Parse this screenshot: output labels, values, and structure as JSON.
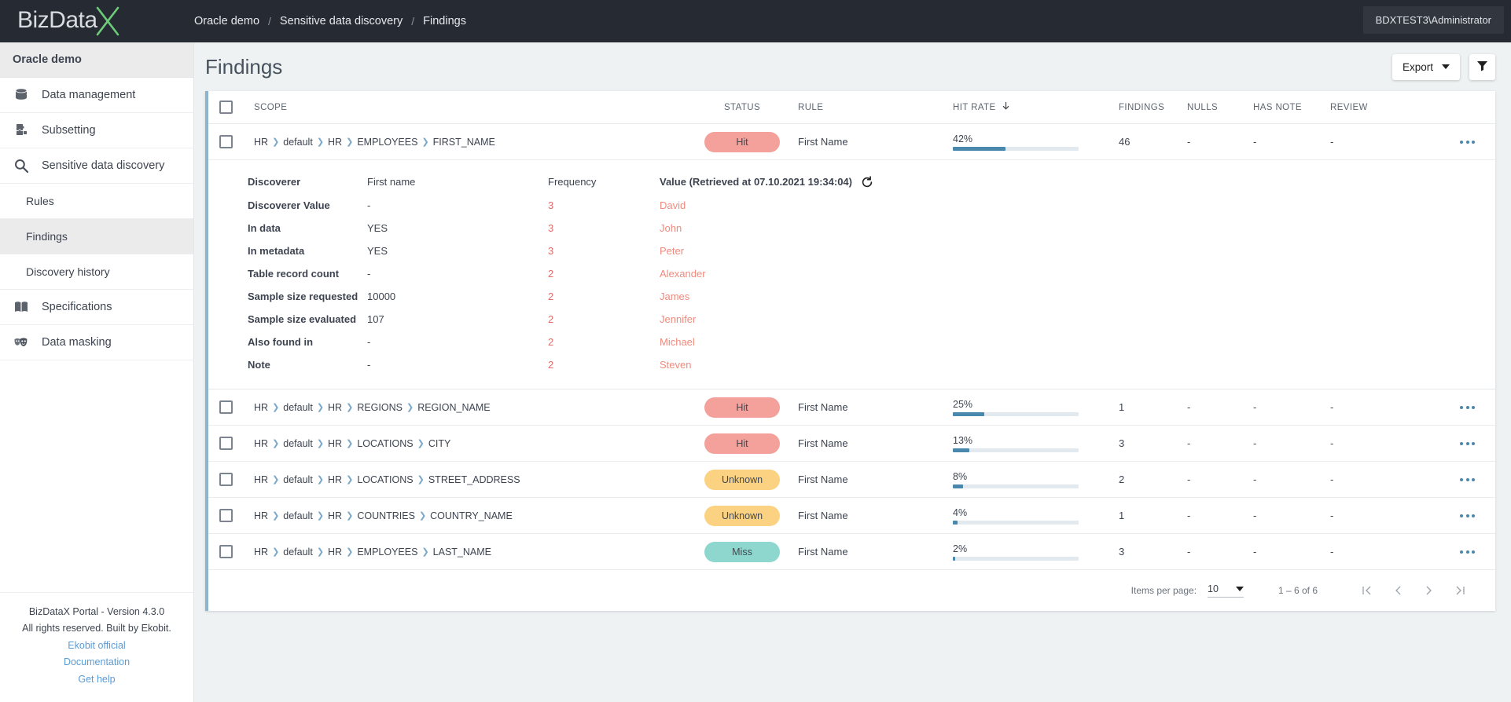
{
  "topbar": {
    "logo_text": "BizData",
    "logo_mark": "x-logo-icon",
    "breadcrumb": [
      "Oracle demo",
      "Sensitive data discovery",
      "Findings"
    ],
    "separator": "/",
    "user": "BDXTEST3\\Administrator"
  },
  "sidebar": {
    "project": "Oracle demo",
    "items": [
      {
        "label": "Data management",
        "icon": "database-icon",
        "sub": false,
        "active": false
      },
      {
        "label": "Subsetting",
        "icon": "puzzle-icon",
        "sub": false,
        "active": false
      },
      {
        "label": "Sensitive data discovery",
        "icon": "search-icon",
        "sub": false,
        "active": false
      },
      {
        "label": "Rules",
        "icon": "",
        "sub": true,
        "active": false
      },
      {
        "label": "Findings",
        "icon": "",
        "sub": true,
        "active": true
      },
      {
        "label": "Discovery history",
        "icon": "",
        "sub": true,
        "active": false
      },
      {
        "label": "Specifications",
        "icon": "book-icon",
        "sub": false,
        "active": false
      },
      {
        "label": "Data masking",
        "icon": "masks-icon",
        "sub": false,
        "active": false
      }
    ],
    "footer": {
      "version": "BizDataX Portal - Version 4.3.0",
      "rights": "All rights reserved. Built by Ekobit.",
      "links": [
        "Ekobit official",
        "Documentation",
        "Get help"
      ]
    }
  },
  "page": {
    "title": "Findings",
    "export_label": "Export",
    "filter_icon": "filter-icon"
  },
  "table": {
    "columns": [
      "SCOPE",
      "STATUS",
      "RULE",
      "HIT RATE",
      "FINDINGS",
      "NULLS",
      "HAS NOTE",
      "REVIEW"
    ],
    "sort_column": "HIT RATE",
    "sort_direction": "desc",
    "rows": [
      {
        "scope": [
          "HR",
          "default",
          "HR",
          "EMPLOYEES",
          "FIRST_NAME"
        ],
        "status": "Hit",
        "status_type": "hit",
        "rule": "First Name",
        "hit_rate": "42%",
        "hit_rate_value": 42,
        "findings": "46",
        "nulls": "-",
        "has_note": "-",
        "review": "-",
        "expanded": true
      },
      {
        "scope": [
          "HR",
          "default",
          "HR",
          "REGIONS",
          "REGION_NAME"
        ],
        "status": "Hit",
        "status_type": "hit",
        "rule": "First Name",
        "hit_rate": "25%",
        "hit_rate_value": 25,
        "findings": "1",
        "nulls": "-",
        "has_note": "-",
        "review": "-",
        "expanded": false
      },
      {
        "scope": [
          "HR",
          "default",
          "HR",
          "LOCATIONS",
          "CITY"
        ],
        "status": "Hit",
        "status_type": "hit",
        "rule": "First Name",
        "hit_rate": "13%",
        "hit_rate_value": 13,
        "findings": "3",
        "nulls": "-",
        "has_note": "-",
        "review": "-",
        "expanded": false
      },
      {
        "scope": [
          "HR",
          "default",
          "HR",
          "LOCATIONS",
          "STREET_ADDRESS"
        ],
        "status": "Unknown",
        "status_type": "unknown",
        "rule": "First Name",
        "hit_rate": "8%",
        "hit_rate_value": 8,
        "findings": "2",
        "nulls": "-",
        "has_note": "-",
        "review": "-",
        "expanded": false
      },
      {
        "scope": [
          "HR",
          "default",
          "HR",
          "COUNTRIES",
          "COUNTRY_NAME"
        ],
        "status": "Unknown",
        "status_type": "unknown",
        "rule": "First Name",
        "hit_rate": "4%",
        "hit_rate_value": 4,
        "findings": "1",
        "nulls": "-",
        "has_note": "-",
        "review": "-",
        "expanded": false
      },
      {
        "scope": [
          "HR",
          "default",
          "HR",
          "EMPLOYEES",
          "LAST_NAME"
        ],
        "status": "Miss",
        "status_type": "miss",
        "rule": "First Name",
        "hit_rate": "2%",
        "hit_rate_value": 2,
        "findings": "3",
        "nulls": "-",
        "has_note": "-",
        "review": "-",
        "expanded": false
      }
    ]
  },
  "detail": {
    "headers": {
      "property": "Discoverer",
      "property_value": "First name",
      "frequency": "Frequency",
      "value": "Value (Retrieved at 07.10.2021 19:34:04)",
      "refresh_icon": "refresh-icon"
    },
    "properties": [
      {
        "label": "Discoverer Value",
        "value": "-"
      },
      {
        "label": "In data",
        "value": "YES"
      },
      {
        "label": "In metadata",
        "value": "YES"
      },
      {
        "label": "Table record count",
        "value": "-"
      },
      {
        "label": "Sample size requested",
        "value": "10000"
      },
      {
        "label": "Sample size evaluated",
        "value": "107"
      },
      {
        "label": "Also found in",
        "value": "-"
      },
      {
        "label": "Note",
        "value": "-"
      }
    ],
    "frequencies": [
      "3",
      "3",
      "3",
      "2",
      "2",
      "2",
      "2",
      "2"
    ],
    "values": [
      "David",
      "John",
      "Peter",
      "Alexander",
      "James",
      "Jennifer",
      "Michael",
      "Steven"
    ]
  },
  "paginator": {
    "items_per_page_label": "Items per page:",
    "items_per_page_value": "10",
    "range": "1 – 6 of 6",
    "first_icon": "first-page-icon",
    "prev_icon": "prev-page-icon",
    "next_icon": "next-page-icon",
    "last_icon": "last-page-icon"
  },
  "colors": {
    "accent_bar": "#8fb4cd",
    "hit": "#f4a09b",
    "unknown": "#fbd282",
    "miss": "#8ed7cf",
    "progress": "#4a87ad",
    "topbar": "#262b33"
  }
}
